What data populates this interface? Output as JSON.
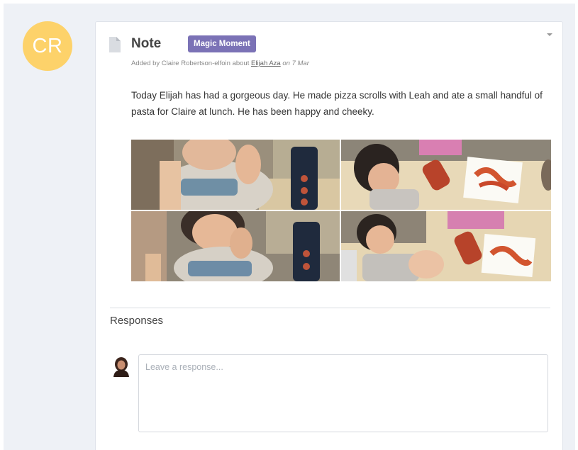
{
  "author_avatar": {
    "initials": "CR",
    "color": "#fdd26a"
  },
  "note": {
    "type_icon": "document-icon",
    "title": "Note",
    "badge": "Magic Moment",
    "badge_color": "#7b72b6",
    "meta": {
      "prefix": "Added by Claire Robertson-elfoin about",
      "child_link": "Elijah Aza",
      "date": "on 7 Mar"
    },
    "body": "Today Elijah has had a gorgeous day. He made pizza scrolls with Leah and ate a small handful of pasta for Claire at lunch. He has been happy and cheeky.",
    "photos": [
      {
        "name": "photo-eating-top"
      },
      {
        "name": "photo-painting-top"
      },
      {
        "name": "photo-eating-bottom"
      },
      {
        "name": "photo-painting-bottom"
      }
    ]
  },
  "responses": {
    "label": "Responses",
    "placeholder": "Leave a response..."
  }
}
